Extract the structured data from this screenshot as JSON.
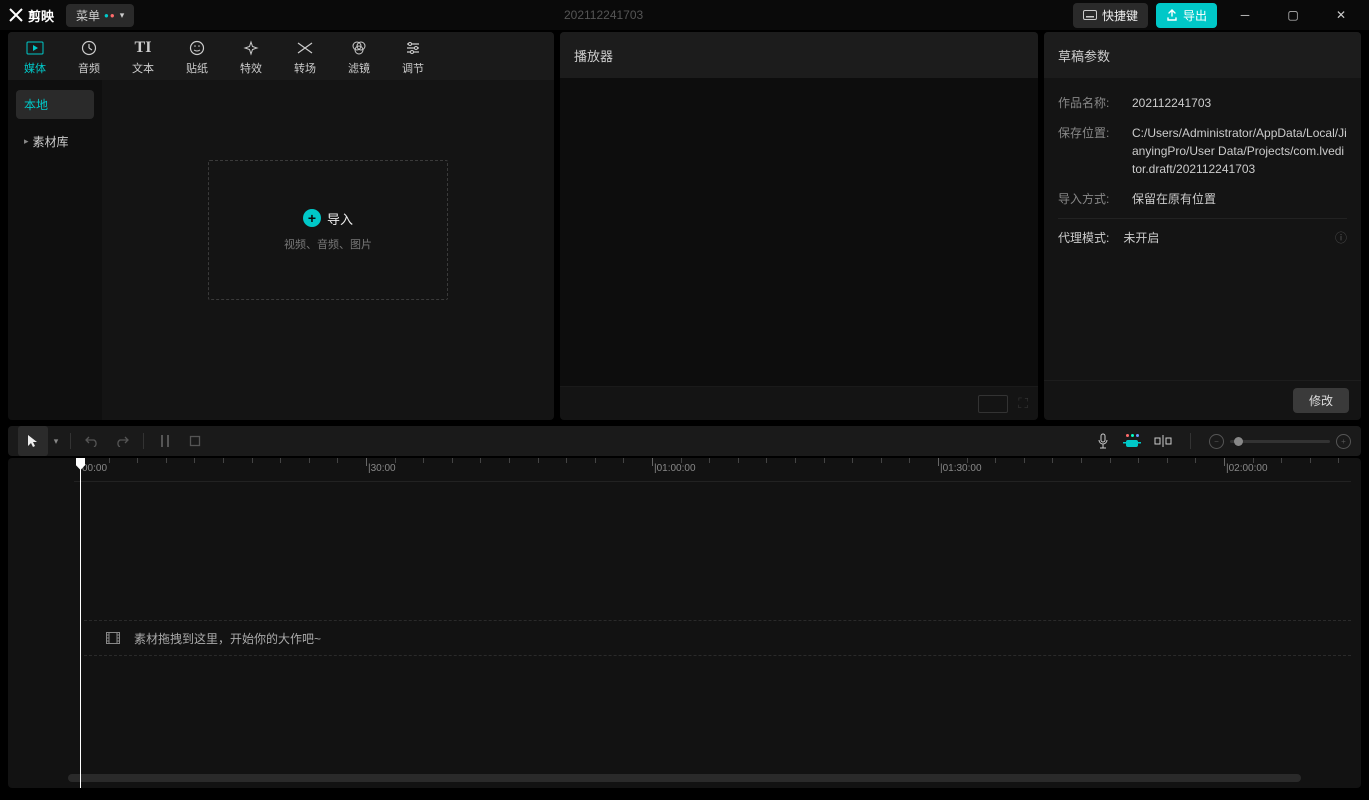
{
  "titlebar": {
    "app_name": "剪映",
    "menu_label": "菜单",
    "project_title": "202112241703",
    "hotkey_label": "快捷键",
    "export_label": "导出"
  },
  "tabs": [
    {
      "label": "媒体",
      "icon": "▣"
    },
    {
      "label": "音频",
      "icon": "◔"
    },
    {
      "label": "文本",
      "icon": "TI"
    },
    {
      "label": "贴纸",
      "icon": "☺"
    },
    {
      "label": "特效",
      "icon": "✦"
    },
    {
      "label": "转场",
      "icon": "⋈"
    },
    {
      "label": "滤镜",
      "icon": "⊗"
    },
    {
      "label": "调节",
      "icon": "≡"
    }
  ],
  "media_side": {
    "local": "本地",
    "library": "素材库"
  },
  "dropzone": {
    "import_label": "导入",
    "subtitle": "视频、音频、图片"
  },
  "player": {
    "title": "播放器"
  },
  "draft": {
    "title": "草稿参数",
    "name_label": "作品名称:",
    "name_value": "202112241703",
    "save_label": "保存位置:",
    "save_value": "C:/Users/Administrator/AppData/Local/JianyingPro/User Data/Projects/com.lveditor.draft/202112241703",
    "import_mode_label": "导入方式:",
    "import_mode_value": "保留在原有位置",
    "proxy_label": "代理模式:",
    "proxy_value": "未开启",
    "modify_button": "修改"
  },
  "timeline": {
    "marks": [
      "00:00",
      "|30:00",
      "|01:00:00",
      "|01:30:00",
      "|02:00:00"
    ],
    "drag_hint": "素材拖拽到这里，开始你的大作吧~"
  }
}
